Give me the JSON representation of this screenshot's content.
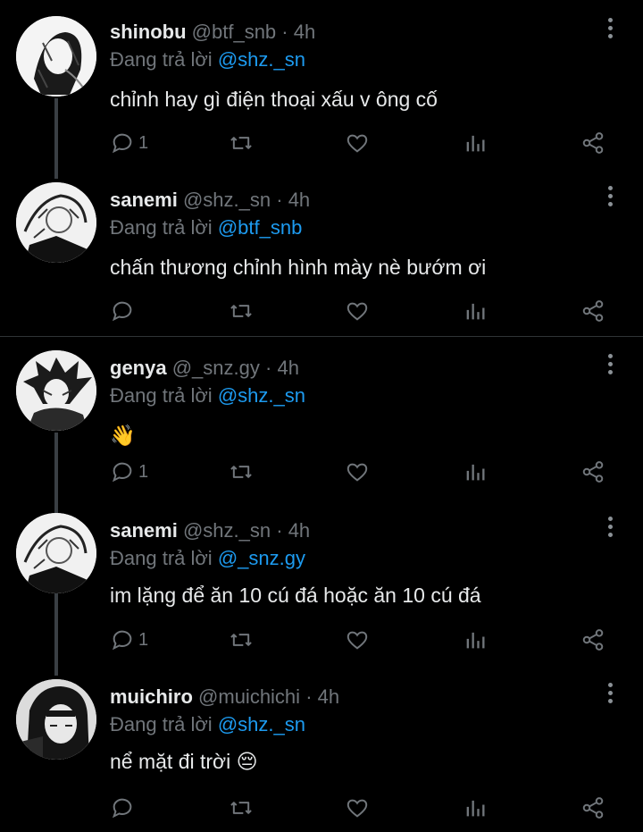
{
  "tweets": [
    {
      "name": "shinobu",
      "handle": "@btf_snb",
      "dot": "·",
      "time": "4h",
      "reply_prefix": "Đang trả lời",
      "reply_to": "@shz._sn",
      "text": "chỉnh hay gì điện thoại xấu v ông cố",
      "reply_count": "1",
      "retweet_count": "",
      "like_count": ""
    },
    {
      "name": "sanemi",
      "handle": "@shz._sn",
      "dot": "·",
      "time": "4h",
      "reply_prefix": "Đang trả lời",
      "reply_to": "@btf_snb",
      "text": "chấn thương chỉnh hình mày nè bướm ơi",
      "reply_count": "",
      "retweet_count": "",
      "like_count": ""
    },
    {
      "name": "genya",
      "handle": "@_snz.gy",
      "dot": "·",
      "time": "4h",
      "reply_prefix": "Đang trả lời",
      "reply_to": "@shz._sn",
      "text": "👋",
      "reply_count": "1",
      "retweet_count": "",
      "like_count": ""
    },
    {
      "name": "sanemi",
      "handle": "@shz._sn",
      "dot": "·",
      "time": "4h",
      "reply_prefix": "Đang trả lời",
      "reply_to": "@_snz.gy",
      "text": "im lặng để ăn 10 cú đá hoặc ăn 10 cú đá",
      "reply_count": "1",
      "retweet_count": "",
      "like_count": ""
    },
    {
      "name": "muichiro",
      "handle": "@muichichi",
      "dot": "·",
      "time": "4h",
      "reply_prefix": "Đang trả lời",
      "reply_to": "@shz._sn",
      "text": "nể mặt đi trời 😔",
      "reply_count": "",
      "retweet_count": "",
      "like_count": ""
    }
  ],
  "icons": {
    "reply": "reply-icon",
    "retweet": "retweet-icon",
    "like": "heart-icon",
    "views": "views-icon",
    "share": "share-icon",
    "more": "more-icon"
  },
  "colors": {
    "background": "#000000",
    "text": "#e7e9ea",
    "muted": "#71767b",
    "mention": "#1d9bf0"
  }
}
